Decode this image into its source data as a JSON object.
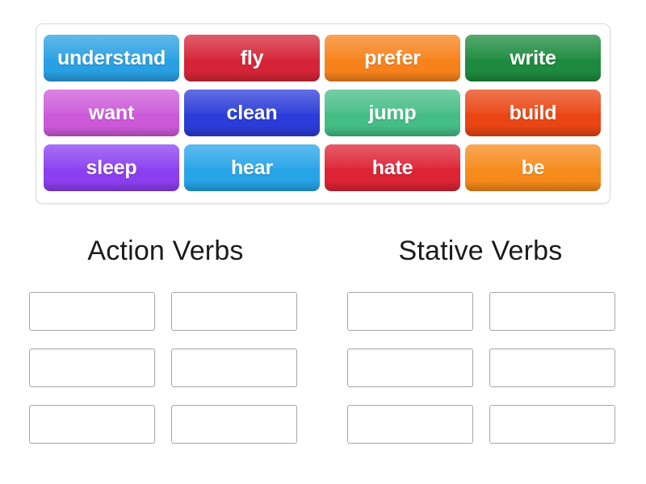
{
  "activity": {
    "type": "group-sort",
    "tray": {
      "tiles": [
        {
          "label": "understand",
          "color": "#29a0e4",
          "row": 0,
          "col": 0
        },
        {
          "label": "fly",
          "color": "#d52437",
          "row": 0,
          "col": 1
        },
        {
          "label": "prefer",
          "color": "#f7821b",
          "row": 0,
          "col": 2
        },
        {
          "label": "write",
          "color": "#1d8a3f",
          "row": 0,
          "col": 3
        },
        {
          "label": "want",
          "color": "#cc5ad8",
          "row": 1,
          "col": 0
        },
        {
          "label": "clean",
          "color": "#2b3cd8",
          "row": 1,
          "col": 1
        },
        {
          "label": "jump",
          "color": "#45bd86",
          "row": 1,
          "col": 2
        },
        {
          "label": "build",
          "color": "#ea4615",
          "row": 1,
          "col": 3
        },
        {
          "label": "sleep",
          "color": "#8b3ff0",
          "row": 2,
          "col": 0
        },
        {
          "label": "hear",
          "color": "#27a4e8",
          "row": 2,
          "col": 1
        },
        {
          "label": "hate",
          "color": "#dc2435",
          "row": 2,
          "col": 2
        },
        {
          "label": "be",
          "color": "#f68a1b",
          "row": 2,
          "col": 3
        }
      ]
    },
    "columns": [
      {
        "heading": "Action Verbs",
        "slots": [
          {
            "value": ""
          },
          {
            "value": ""
          },
          {
            "value": ""
          },
          {
            "value": ""
          },
          {
            "value": ""
          },
          {
            "value": ""
          }
        ]
      },
      {
        "heading": "Stative Verbs",
        "slots": [
          {
            "value": ""
          },
          {
            "value": ""
          },
          {
            "value": ""
          },
          {
            "value": ""
          },
          {
            "value": ""
          },
          {
            "value": ""
          }
        ]
      }
    ],
    "theme": {
      "background": "#ffffff",
      "tray_border": "#d9d9d9",
      "slot_border": "#a6a6a6",
      "heading_color": "#1b1b1b",
      "tile_text_color": "#ffffff"
    }
  }
}
